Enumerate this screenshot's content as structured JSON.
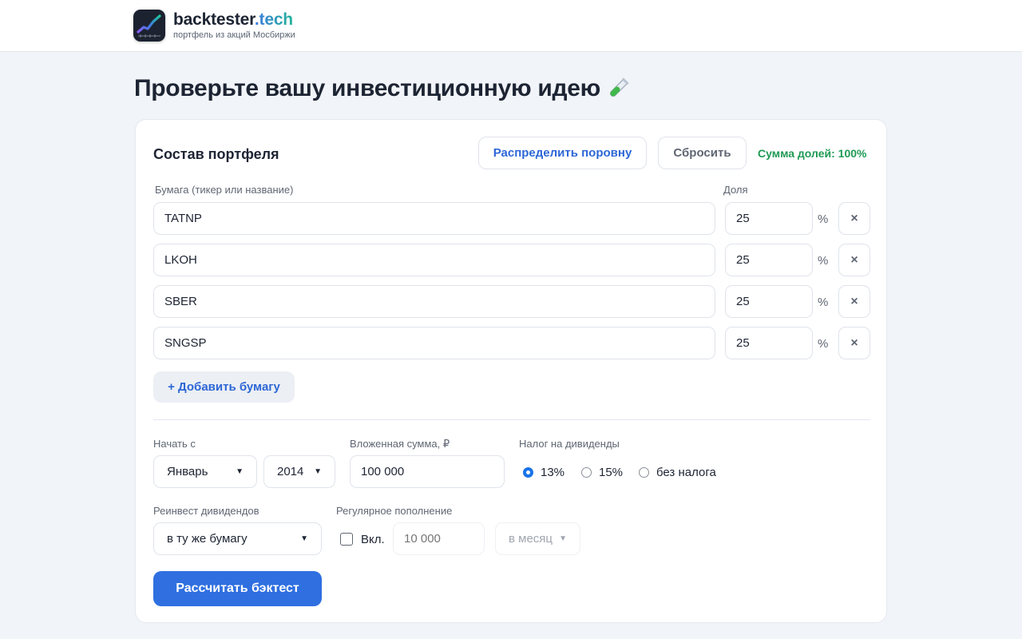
{
  "brand": {
    "name_main": "backtester",
    "name_accent": ".tech",
    "tagline": "портфель из акций Мосбиржи"
  },
  "page": {
    "title": "Проверьте вашу инвестиционную идею"
  },
  "portfolio": {
    "title": "Состав портфеля",
    "distribute_label": "Распределить поровну",
    "reset_label": "Сбросить",
    "sum_label": "Сумма долей: 100%",
    "ticker_column": "Бумага (тикер или название)",
    "share_column": "Доля",
    "percent_sign": "%",
    "delete_glyph": "×",
    "rows": [
      {
        "ticker": "TATNP",
        "share": "25"
      },
      {
        "ticker": "LKOH",
        "share": "25"
      },
      {
        "ticker": "SBER",
        "share": "25"
      },
      {
        "ticker": "SNGSP",
        "share": "25"
      }
    ],
    "add_label": "+ Добавить бумагу"
  },
  "settings": {
    "start_label": "Начать с",
    "start_month": "Январь",
    "start_year": "2014",
    "amount_label": "Вложенная сумма, ₽",
    "amount_value": "100 000",
    "tax_label": "Налог на дивиденды",
    "tax_options": [
      "13%",
      "15%",
      "без налога"
    ],
    "tax_selected": "13%",
    "reinvest_label": "Реинвест дивидендов",
    "reinvest_value": "в ту же бумагу",
    "topup_label": "Регулярное пополнение",
    "topup_enabled_label": "Вкл.",
    "topup_placeholder": "10 000",
    "topup_period": "в месяц",
    "submit_label": "Рассчитать бэктест"
  },
  "colors": {
    "primary": "#2f6fe0",
    "success": "#1f9a55",
    "link": "#2d67d6"
  },
  "icons": {
    "logo": "chart-logo-icon",
    "title_emoji": "test-tube-icon",
    "select": "chevron-down-icon",
    "delete": "close-icon"
  }
}
